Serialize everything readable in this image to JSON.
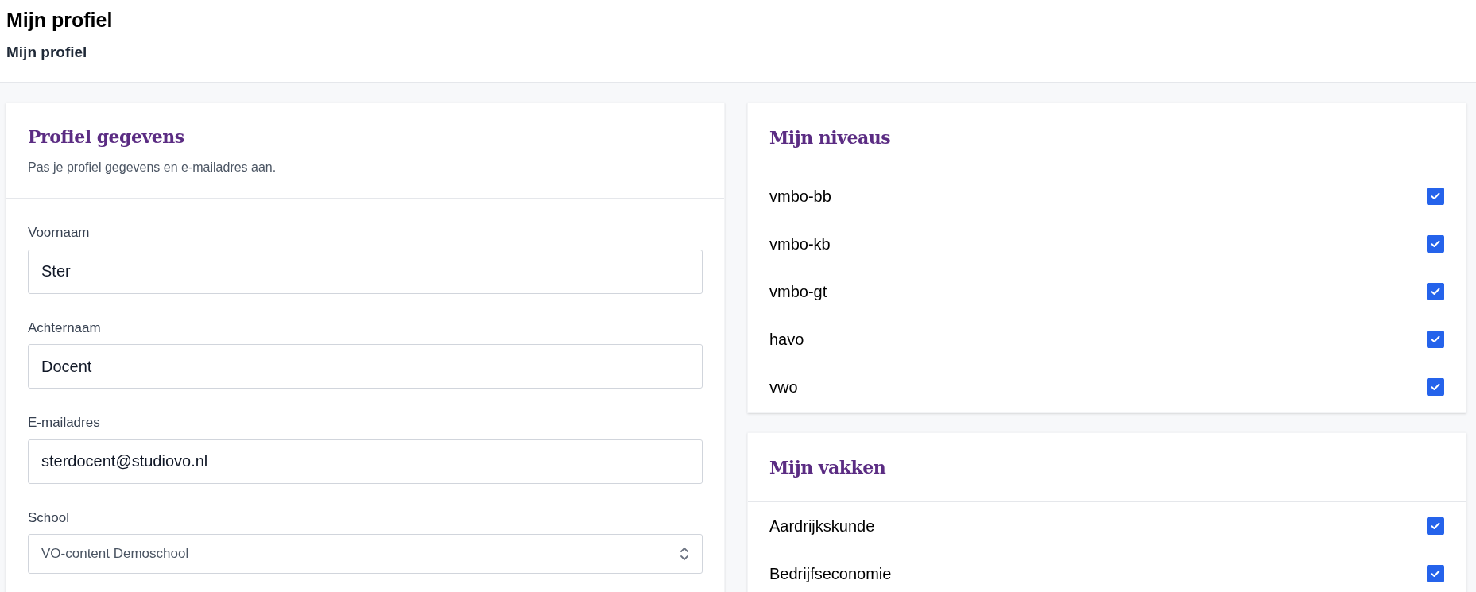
{
  "page": {
    "title": "Mijn profiel",
    "breadcrumb": "Mijn profiel"
  },
  "profile": {
    "title": "Profiel gegevens",
    "description": "Pas je profiel gegevens en e-mailadres aan.",
    "fields": [
      {
        "kind": "text",
        "label": "Voornaam",
        "value": "Ster"
      },
      {
        "kind": "text",
        "label": "Achternaam",
        "value": "Docent"
      },
      {
        "kind": "text",
        "label": "E-mailadres",
        "value": "sterdocent@studiovo.nl"
      },
      {
        "kind": "select",
        "label": "School",
        "value": "VO-content Demoschool"
      }
    ]
  },
  "levels": {
    "title": "Mijn niveaus",
    "items": [
      {
        "label": "vmbo-bb",
        "checked": true
      },
      {
        "label": "vmbo-kb",
        "checked": true
      },
      {
        "label": "vmbo-gt",
        "checked": true
      },
      {
        "label": "havo",
        "checked": true
      },
      {
        "label": "vwo",
        "checked": true
      }
    ]
  },
  "subjects": {
    "title": "Mijn vakken",
    "items": [
      {
        "label": "Aardrijkskunde",
        "checked": true
      },
      {
        "label": "Bedrijfseconomie",
        "checked": true
      }
    ]
  }
}
